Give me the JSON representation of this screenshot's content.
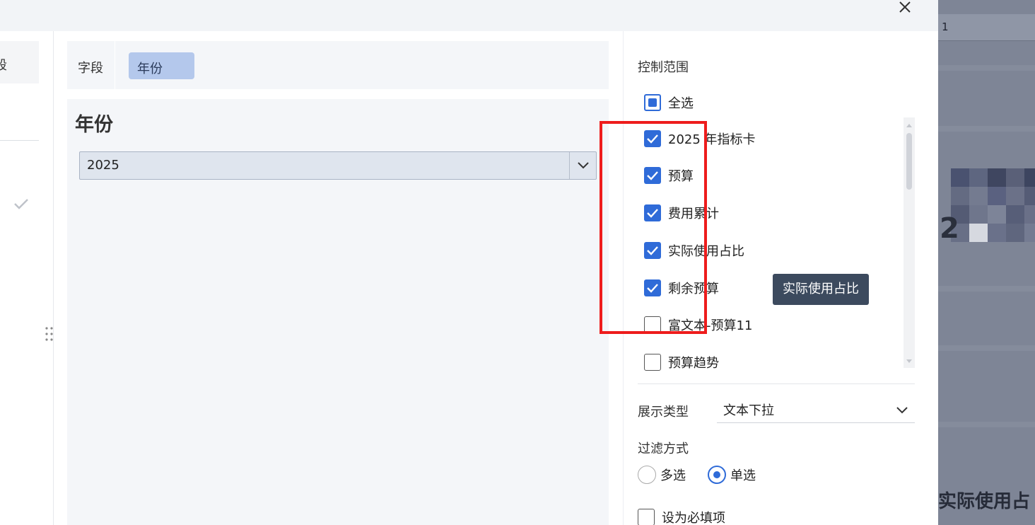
{
  "dialog": {
    "close_icon": "close-icon"
  },
  "left": {
    "tab_label": "段",
    "check_icon": "check-icon",
    "drag_icon": "drag-handle-icon"
  },
  "field_bar": {
    "label": "字段",
    "chip": "年份"
  },
  "preview": {
    "title": "年份",
    "select_value": "2025"
  },
  "right": {
    "scope_label": "控制范围",
    "select_all": "全选",
    "items": [
      {
        "label": "2025 年指标卡",
        "checked": true
      },
      {
        "label": "预算",
        "checked": true
      },
      {
        "label": "费用累计",
        "checked": true
      },
      {
        "label": "实际使用占比",
        "checked": true
      },
      {
        "label": "剩余预算",
        "checked": true
      },
      {
        "label": "富文本-预算11",
        "checked": false
      },
      {
        "label": "预算趋势",
        "checked": false
      }
    ],
    "tooltip": "实际使用占比",
    "display_type_label": "展示类型",
    "display_type_value": "文本下拉",
    "filter_label": "过滤方式",
    "filter_options": [
      "多选",
      "单选"
    ],
    "filter_selected": "单选",
    "required_label": "设为必填项"
  },
  "background": {
    "header_text": "1",
    "big_digit": "2",
    "bottom_text": "实际使用占"
  },
  "colors": {
    "accent": "#2f6bd8",
    "annotation": "#ee1c1c",
    "tooltip_bg": "#3c4a5e",
    "chip_bg": "#b4c8ec"
  }
}
